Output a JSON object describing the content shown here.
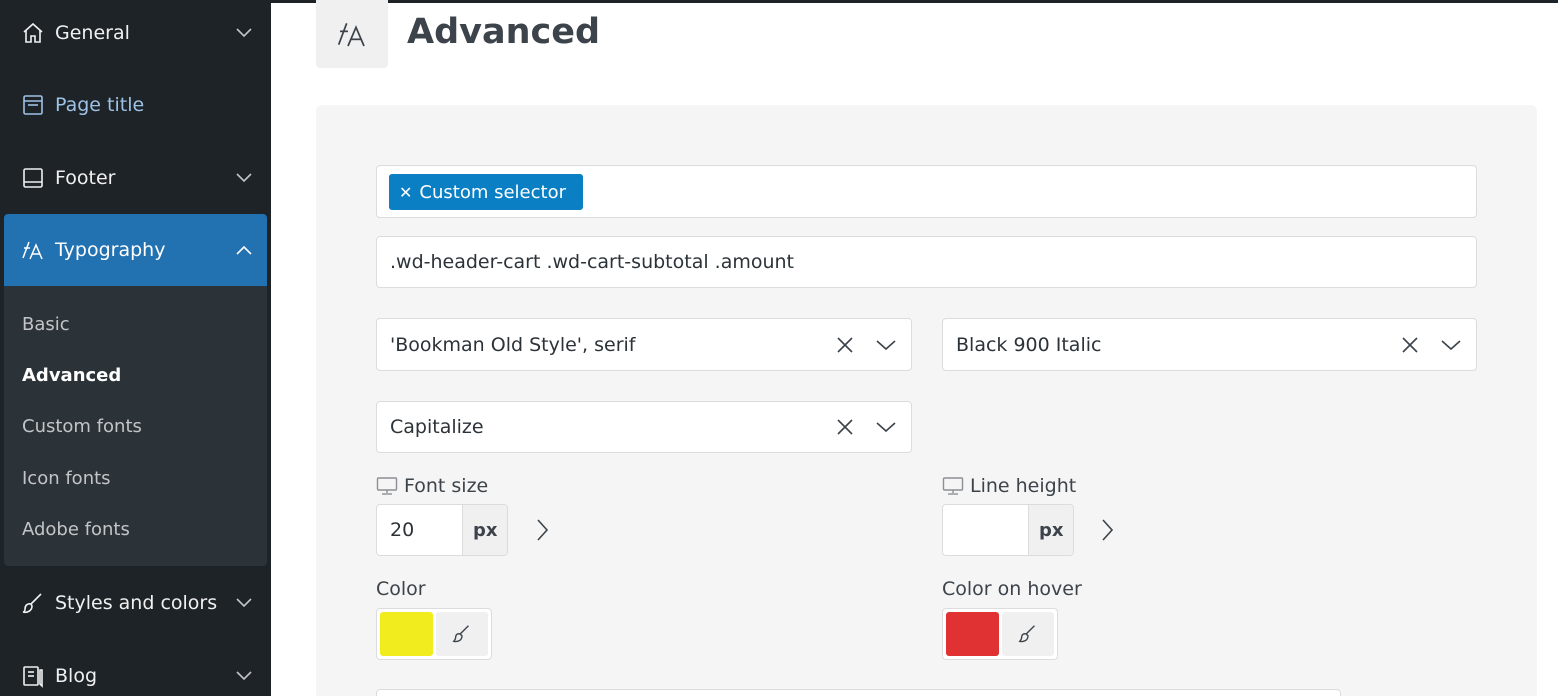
{
  "sidebar": {
    "items": [
      {
        "label": "General",
        "icon": "home-icon"
      },
      {
        "label": "Page title",
        "icon": "page-title-icon"
      },
      {
        "label": "Footer",
        "icon": "footer-icon"
      },
      {
        "label": "Typography",
        "icon": "typography-icon"
      },
      {
        "label": "Styles and colors",
        "icon": "brush-icon"
      },
      {
        "label": "Blog",
        "icon": "blog-icon"
      }
    ],
    "submenu": [
      "Basic",
      "Advanced",
      "Custom fonts",
      "Icon fonts",
      "Adobe fonts"
    ],
    "active_color": "#2271b1"
  },
  "header": {
    "title": "Advanced",
    "icon": "typography-icon"
  },
  "form": {
    "tag_label": "Custom selector",
    "selector_value": ".wd-header-cart .wd-cart-subtotal .amount",
    "font_family": "'Bookman Old Style', serif",
    "font_weight": "Black 900 Italic",
    "text_transform": "Capitalize",
    "font_size_label": "Font size",
    "font_size_value": "20",
    "font_size_unit": "px",
    "line_height_label": "Line height",
    "line_height_value": "",
    "line_height_unit": "px",
    "color_label": "Color",
    "color_value": "#f0ec1e",
    "hover_color_label": "Color on hover",
    "hover_color_value": "#e03232"
  }
}
